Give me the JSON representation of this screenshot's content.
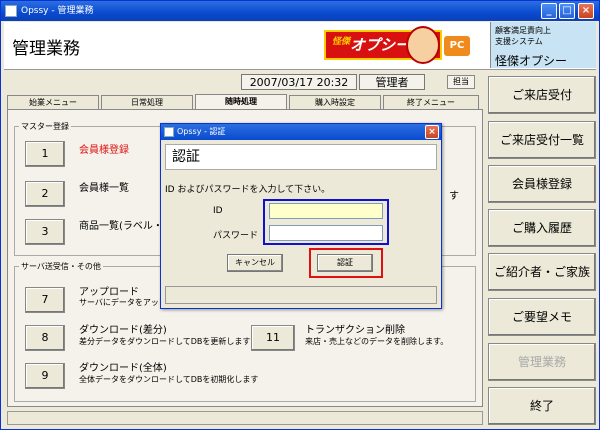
{
  "window": {
    "title": "Opssy - 管理業務"
  },
  "header": {
    "title": "管理業務",
    "logo": {
      "brand_small": "怪傑",
      "brand": "オプシー",
      "badge": "PC"
    },
    "system_info": {
      "line1": "顧客満足責向上",
      "line2": "支援システム",
      "name": "怪傑オプシー"
    }
  },
  "info": {
    "datetime": "2007/03/17 20:32",
    "role": "管理者",
    "tanto_label": "担当"
  },
  "tabs": [
    {
      "label": "始業メニュー"
    },
    {
      "label": "日常処理"
    },
    {
      "label": "随時処理"
    },
    {
      "label": "購入時設定"
    },
    {
      "label": "終了メニュー"
    }
  ],
  "master": {
    "label": "マスター登録",
    "items": [
      {
        "num": "1",
        "label": "会員様登録"
      },
      {
        "num": "2",
        "label": "会員様一覧"
      },
      {
        "num": "3",
        "label": "商品一覧(ラベル・プ"
      }
    ],
    "right_fragment": "す"
  },
  "server": {
    "label": "サーバ送受信・その他",
    "items": [
      {
        "num": "7",
        "label": "アップロード",
        "desc": "サーバにデータをアップロ"
      },
      {
        "num": "8",
        "label": "ダウンロード(差分)",
        "desc": "差分データをダウンロードしてDBを更新します"
      },
      {
        "num": "9",
        "label": "ダウンロード(全体)",
        "desc": "全体データをダウンロードしてDBを初期化します"
      },
      {
        "num": "11",
        "label": "トランザクション削除",
        "desc": "来店・売上などのデータを削除します。"
      }
    ]
  },
  "sidebar": [
    {
      "label": "ご来店受付"
    },
    {
      "label": "ご来店受付一覧"
    },
    {
      "label": "会員様登録"
    },
    {
      "label": "ご購入履歴"
    },
    {
      "label": "ご紹介者・ご家族"
    },
    {
      "label": "ご要望メモ"
    },
    {
      "label": "管理業務"
    },
    {
      "label": "終了"
    }
  ],
  "dialog": {
    "title": "Opssy - 認証",
    "heading": "認証",
    "prompt": "ID およびパスワードを入力して下さい。",
    "id_label": "ID",
    "password_label": "パスワード",
    "id_value": "",
    "password_value": "",
    "cancel_label": "キャンセル",
    "ok_label": "認証"
  },
  "colors": {
    "highlight_blue": "#1010d0",
    "highlight_red": "#e01010",
    "accent_red": "#e01010"
  }
}
